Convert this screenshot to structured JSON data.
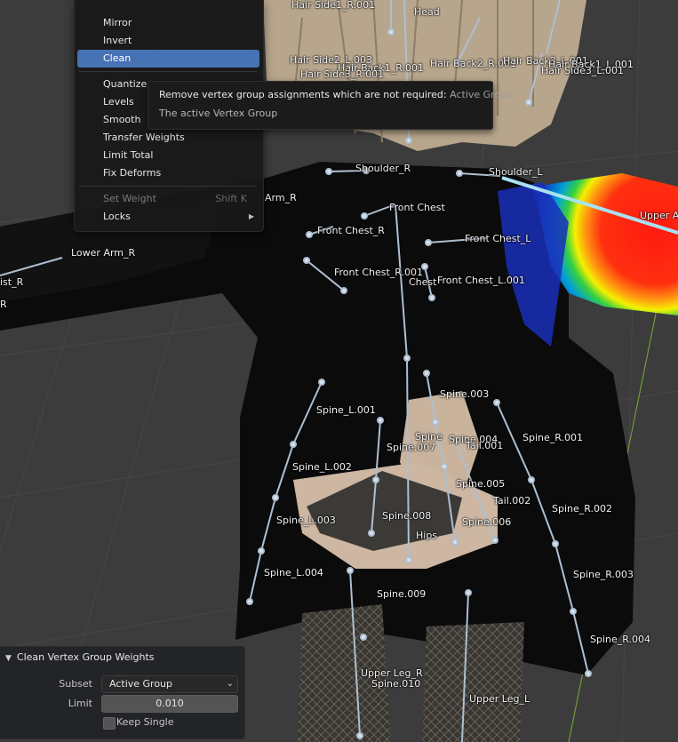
{
  "menu": {
    "items": [
      {
        "label": "Mirror"
      },
      {
        "label": "Invert"
      },
      {
        "label": "Clean"
      },
      {
        "label": "Quantize"
      },
      {
        "label": "Levels"
      },
      {
        "label": "Smooth"
      },
      {
        "label": "Transfer Weights"
      },
      {
        "label": "Limit Total"
      },
      {
        "label": "Fix Deforms"
      },
      {
        "label": "Set Weight",
        "shortcut": "Shift K"
      },
      {
        "label": "Locks"
      }
    ]
  },
  "tooltip": {
    "text": "Remove vertex group assignments which are not required:",
    "value": "Active Group",
    "detail": "The active Vertex Group"
  },
  "panel": {
    "title": "Clean Vertex Group Weights",
    "subset_label": "Subset",
    "subset_value": "Active Group",
    "limit_label": "Limit",
    "limit_value": "0.010",
    "keep_single_label": "Keep Single"
  },
  "bones": [
    "Hair Side1_R.001",
    "Head",
    "Hair Side2_L.003",
    "Hair Back1_R.001",
    "Hair Side3_R.001",
    "Hair Back2_R.001",
    "Hair Back3_L.001",
    "Hair Back1_L.001",
    "Hair Side3_L.001",
    "Shoulder_R",
    "Shoulder_L",
    "Arm_R",
    "Front Chest",
    "Upper Arm",
    "Front Chest_R",
    "Front Chest_L",
    "Lower Arm_R",
    "ist_R",
    "R",
    "Front Chest_R.001",
    "Chest",
    "Front Chest_L.001",
    "Spine.003",
    "Spine_L.001",
    "Spine_R.001",
    "Spine",
    "Spine.004",
    "Spine.007",
    "Tail.001",
    "Spine_L.002",
    "Spine.005",
    "Tail.002",
    "Spine_R.002",
    "Spine_L.003",
    "Spine.008",
    "Spine.006",
    "Hips",
    "Spine_L.004",
    "Spine_R.003",
    "Spine.009",
    "Spine_R.004",
    "Upper Leg_R",
    "Spine.010",
    "Upper Leg_L"
  ]
}
